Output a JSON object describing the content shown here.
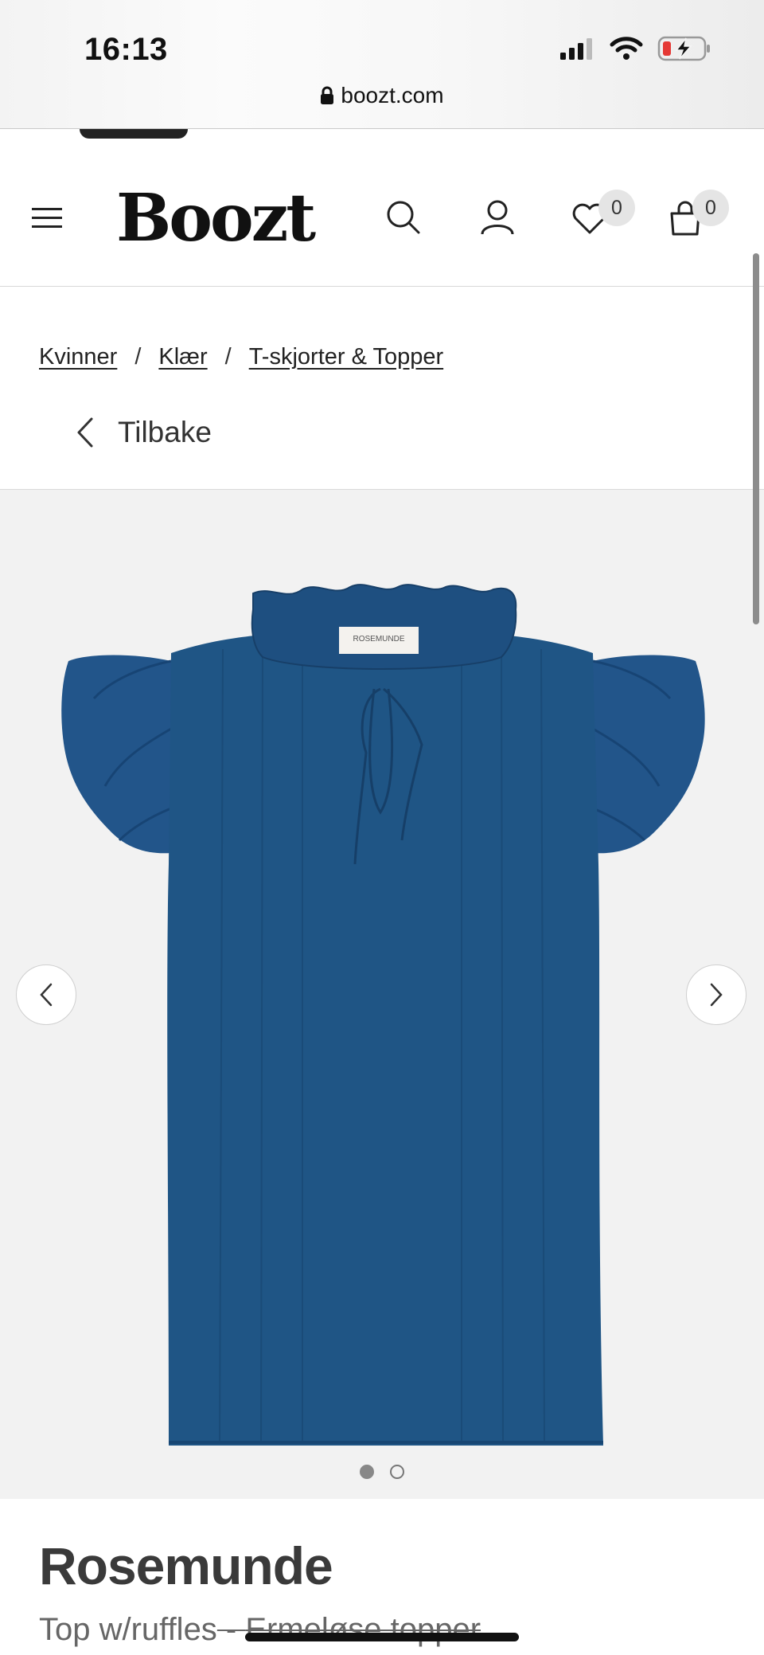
{
  "status_bar": {
    "time": "16:13",
    "url": "boozt.com",
    "icons": [
      "signal-icon",
      "wifi-icon",
      "battery-charging-icon"
    ],
    "battery_low_color": "#e53935"
  },
  "header": {
    "logo": "Boozt",
    "wishlist_count": "0",
    "cart_count": "0",
    "icons": [
      "menu-icon",
      "search-icon",
      "user-icon",
      "heart-icon",
      "bag-icon"
    ]
  },
  "breadcrumbs": [
    {
      "label": "Kvinner"
    },
    {
      "label": "Klær"
    },
    {
      "label": "T-skjorter & Topper"
    }
  ],
  "breadcrumb_separator": "/",
  "back": {
    "label": "Tilbake"
  },
  "gallery": {
    "image_label": "ROSEMUNDE",
    "image_count": 2,
    "active_index": 0,
    "product_color": "#1f5585",
    "background": "#f2f2f2"
  },
  "product": {
    "brand": "Rosemunde",
    "name": "Top w/ruffles",
    "separator": " - ",
    "category": "Ermeløse topper"
  }
}
